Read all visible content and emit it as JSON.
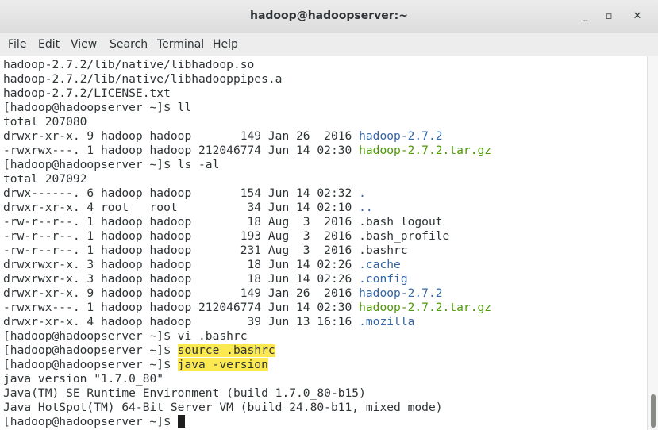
{
  "window": {
    "title": "hadoop@hadoopserver:~",
    "buttons": {
      "minimize": "_",
      "maximize": "▫",
      "close": "✕"
    }
  },
  "menu": [
    "File",
    "Edit",
    "View",
    "Search",
    "Terminal",
    "Help"
  ],
  "terminal": {
    "lines": [
      {
        "text": "hadoop-2.7.2/lib/native/libhadoop.so"
      },
      {
        "text": "hadoop-2.7.2/lib/native/libhadooppipes.a"
      },
      {
        "text": "hadoop-2.7.2/LICENSE.txt"
      },
      {
        "text": "[hadoop@hadoopserver ~]$ ll"
      },
      {
        "text": "total 207080"
      },
      {
        "text": "drwxr-xr-x. 9 hadoop hadoop       149 Jan 26  2016 ",
        "name": "hadoop-2.7.2",
        "color": "blue"
      },
      {
        "text": "-rwxrwx---. 1 hadoop hadoop 212046774 Jun 14 02:30 ",
        "name": "hadoop-2.7.2.tar.gz",
        "color": "green"
      },
      {
        "text": "[hadoop@hadoopserver ~]$ ls -al"
      },
      {
        "text": "total 207092"
      },
      {
        "text": "drwx------. 6 hadoop hadoop       154 Jun 14 02:32 ",
        "name": ".",
        "color": "blue"
      },
      {
        "text": "drwxr-xr-x. 4 root   root          34 Jun 14 02:10 ",
        "name": "..",
        "color": "blue"
      },
      {
        "text": "-rw-r--r--. 1 hadoop hadoop        18 Aug  3  2016 .bash_logout"
      },
      {
        "text": "-rw-r--r--. 1 hadoop hadoop       193 Aug  3  2016 .bash_profile"
      },
      {
        "text": "-rw-r--r--. 1 hadoop hadoop       231 Aug  3  2016 .bashrc"
      },
      {
        "text": "drwxrwxr-x. 3 hadoop hadoop        18 Jun 14 02:26 ",
        "name": ".cache",
        "color": "blue"
      },
      {
        "text": "drwxrwxr-x. 3 hadoop hadoop        18 Jun 14 02:26 ",
        "name": ".config",
        "color": "blue"
      },
      {
        "text": "drwxr-xr-x. 9 hadoop hadoop       149 Jan 26  2016 ",
        "name": "hadoop-2.7.2",
        "color": "blue"
      },
      {
        "text": "-rwxrwx---. 1 hadoop hadoop 212046774 Jun 14 02:30 ",
        "name": "hadoop-2.7.2.tar.gz",
        "color": "green"
      },
      {
        "text": "drwxr-xr-x. 4 hadoop hadoop        39 Jun 13 16:16 ",
        "name": ".mozilla",
        "color": "blue"
      },
      {
        "text": "[hadoop@hadoopserver ~]$ vi .bashrc"
      },
      {
        "text": "[hadoop@hadoopserver ~]$ ",
        "highlight": "source .bashrc"
      },
      {
        "text": "[hadoop@hadoopserver ~]$ ",
        "highlight": "java -version"
      },
      {
        "text": "java version \"1.7.0_80\""
      },
      {
        "text": "Java(TM) SE Runtime Environment (build 1.7.0_80-b15)"
      },
      {
        "text": "Java HotSpot(TM) 64-Bit Server VM (build 24.80-b11, mixed mode)"
      },
      {
        "text": "[hadoop@hadoopserver ~]$ ",
        "cursor": true
      }
    ]
  },
  "colors": {
    "blue": "#3465a4",
    "green": "#4e9a06",
    "highlight": "#fce94f"
  }
}
